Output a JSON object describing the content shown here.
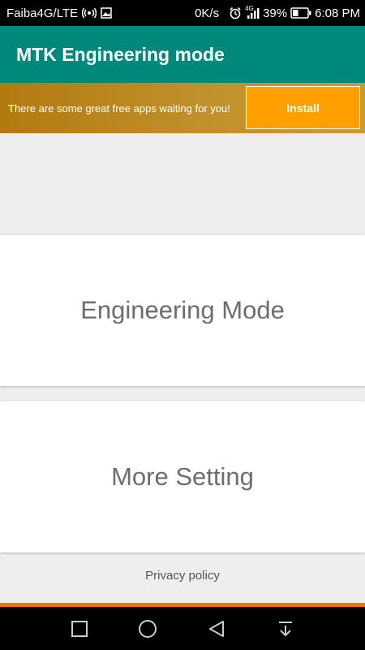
{
  "status_bar": {
    "carrier": "Faiba4G/LTE",
    "speed": "0K/s",
    "network_type": "4G",
    "battery": "39%",
    "battery_level": 0.39,
    "time": "6:08 PM",
    "icons": [
      "wifi-hotspot-icon",
      "image-icon",
      "alarm-icon",
      "signal-icon",
      "battery-icon"
    ]
  },
  "app_bar": {
    "title": "MTK Engineering mode",
    "color": "#00897b"
  },
  "ad": {
    "text": "There are some great free apps waiting for you!",
    "button_label": "Install",
    "button_color": "#ffa000"
  },
  "cards": {
    "engineering_mode": "Engineering Mode",
    "more_setting": "More Setting"
  },
  "footer": {
    "privacy_policy": "Privacy policy"
  },
  "nav_bar": {
    "icons": [
      "recent-apps-icon",
      "home-icon",
      "back-icon",
      "notification-pull-icon"
    ]
  }
}
